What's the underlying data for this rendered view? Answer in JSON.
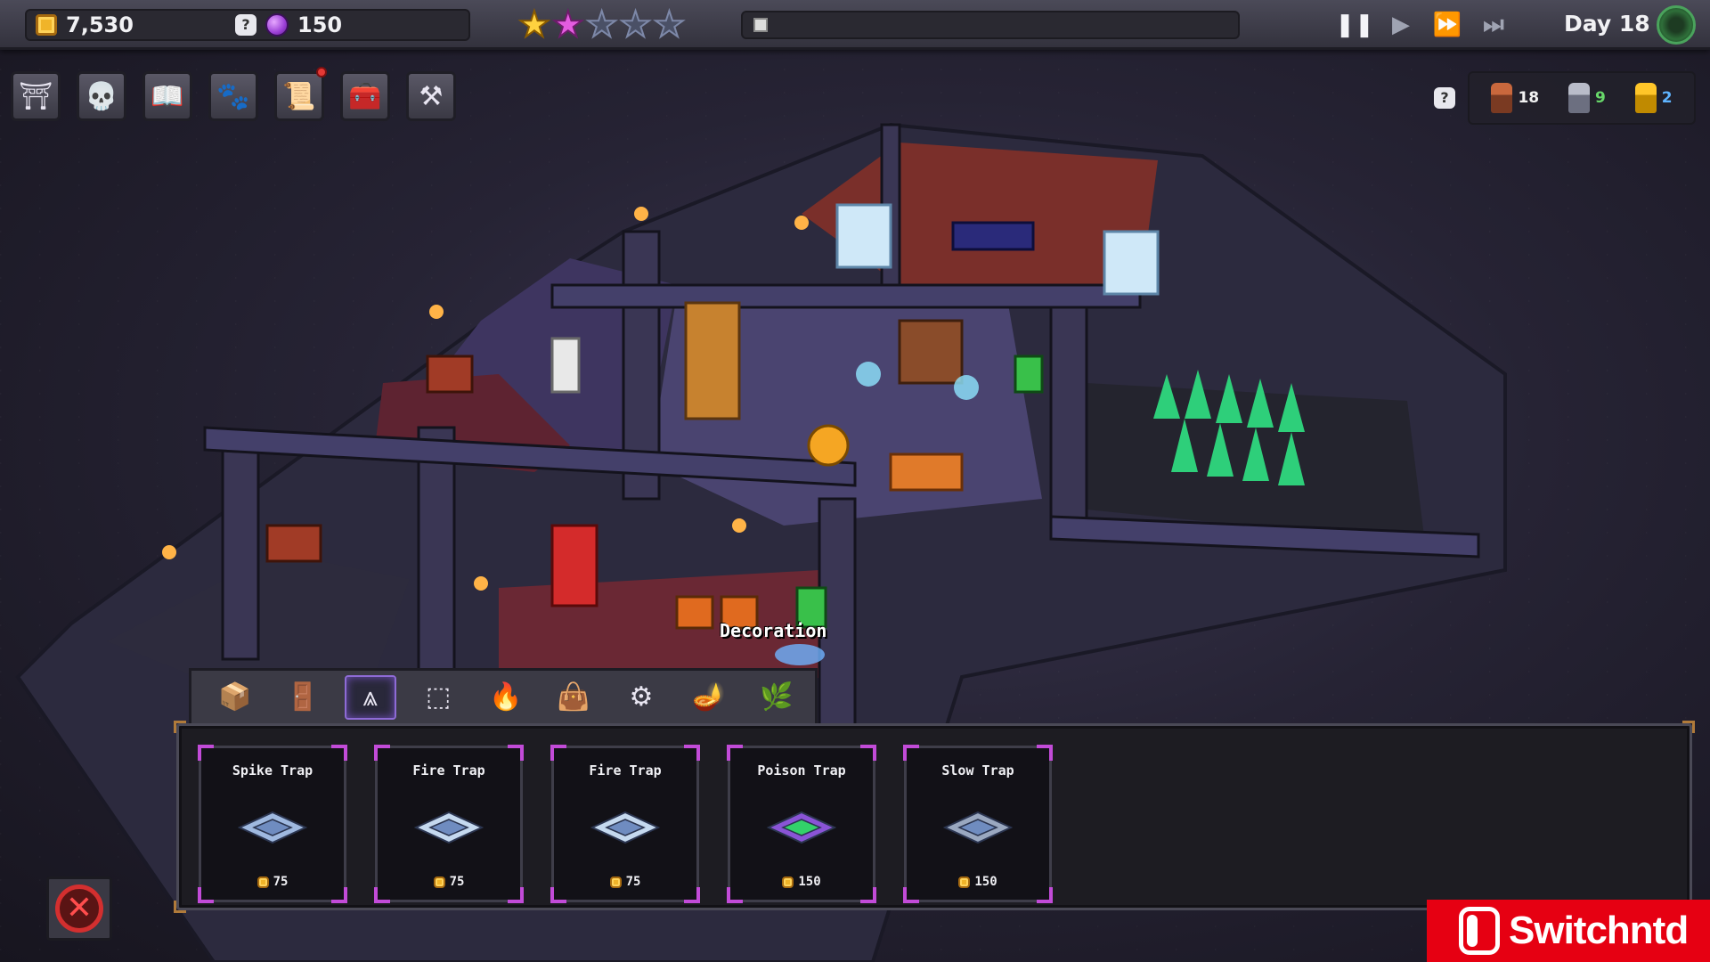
{
  "resources": {
    "gold": "7,530",
    "souls": "150",
    "gold_icon": "gold-coin-icon",
    "soul_icon": "purple-soul-icon"
  },
  "rating": {
    "stars_filled": 2,
    "stars_total": 5,
    "colors": {
      "gold": "#ffd23f",
      "pink": "#e45ce0",
      "empty": "#4a5066"
    }
  },
  "day_progress": {
    "fraction": 0.0
  },
  "speed_controls": [
    {
      "id": "pause",
      "icon": "pause-icon",
      "glyph": "❚❚",
      "active": true
    },
    {
      "id": "play",
      "icon": "play-icon",
      "glyph": "▶",
      "active": false
    },
    {
      "id": "fast",
      "icon": "fast-forward-icon",
      "glyph": "⏩",
      "active": false
    },
    {
      "id": "fastest",
      "icon": "skip-forward-icon",
      "glyph": "⏭",
      "active": false
    }
  ],
  "day": "Day 18",
  "build_menu": [
    {
      "icon": "dungeon-gate-icon",
      "glyph": "⛩",
      "notification": false
    },
    {
      "icon": "skull-icon",
      "glyph": "💀",
      "notification": false
    },
    {
      "icon": "spellbook-icon",
      "glyph": "📖",
      "notification": false
    },
    {
      "icon": "paw-icon",
      "glyph": "🐾",
      "notification": false
    },
    {
      "icon": "quest-board-icon",
      "glyph": "📜",
      "notification": true
    },
    {
      "icon": "treasure-chest-icon",
      "glyph": "🧰",
      "notification": false
    },
    {
      "icon": "worker-icon",
      "glyph": "⚒",
      "notification": false
    }
  ],
  "population": [
    {
      "icon": "worker-minion-icon",
      "count": "18",
      "color": "#f2f2f2"
    },
    {
      "icon": "knight-minion-icon",
      "count": "9",
      "color": "#68d86a"
    },
    {
      "icon": "gold-minion-icon",
      "count": "2",
      "color": "#5fb4ff"
    }
  ],
  "hover_label": "Decoration",
  "category_tabs": [
    {
      "icon": "storage-crate-icon",
      "glyph": "📦",
      "selected": false
    },
    {
      "icon": "wardrobe-icon",
      "glyph": "🚪",
      "selected": false
    },
    {
      "icon": "spike-trap-tab-icon",
      "glyph": "⩓",
      "selected": true
    },
    {
      "icon": "pressure-plate-icon",
      "glyph": "⬚",
      "selected": false
    },
    {
      "icon": "torch-icon",
      "glyph": "🔥",
      "selected": false
    },
    {
      "icon": "sack-icon",
      "glyph": "👜",
      "selected": false
    },
    {
      "icon": "anvil-icon",
      "glyph": "⚙",
      "selected": false
    },
    {
      "icon": "lamp-icon",
      "glyph": "🪔",
      "selected": false
    },
    {
      "icon": "potted-plant-icon",
      "glyph": "🌿",
      "selected": false
    }
  ],
  "traps": [
    {
      "name": "Spike Trap",
      "cost": "75",
      "icon": "spike-trap-icon",
      "color": "#9fb9e0"
    },
    {
      "name": "Fire Trap",
      "cost": "75",
      "icon": "fire-trap-icon",
      "color": "#c5d9ef"
    },
    {
      "name": "Fire Trap",
      "cost": "75",
      "icon": "fire-trap-icon",
      "color": "#c5d9ef"
    },
    {
      "name": "Poison Trap",
      "cost": "150",
      "icon": "poison-trap-icon",
      "color": "#8a54d6"
    },
    {
      "name": "Slow Trap",
      "cost": "150",
      "icon": "slow-trap-icon",
      "color": "#9aa8c0"
    }
  ],
  "cancel_icon": "cancel-icon",
  "watermark": "Switchntd"
}
